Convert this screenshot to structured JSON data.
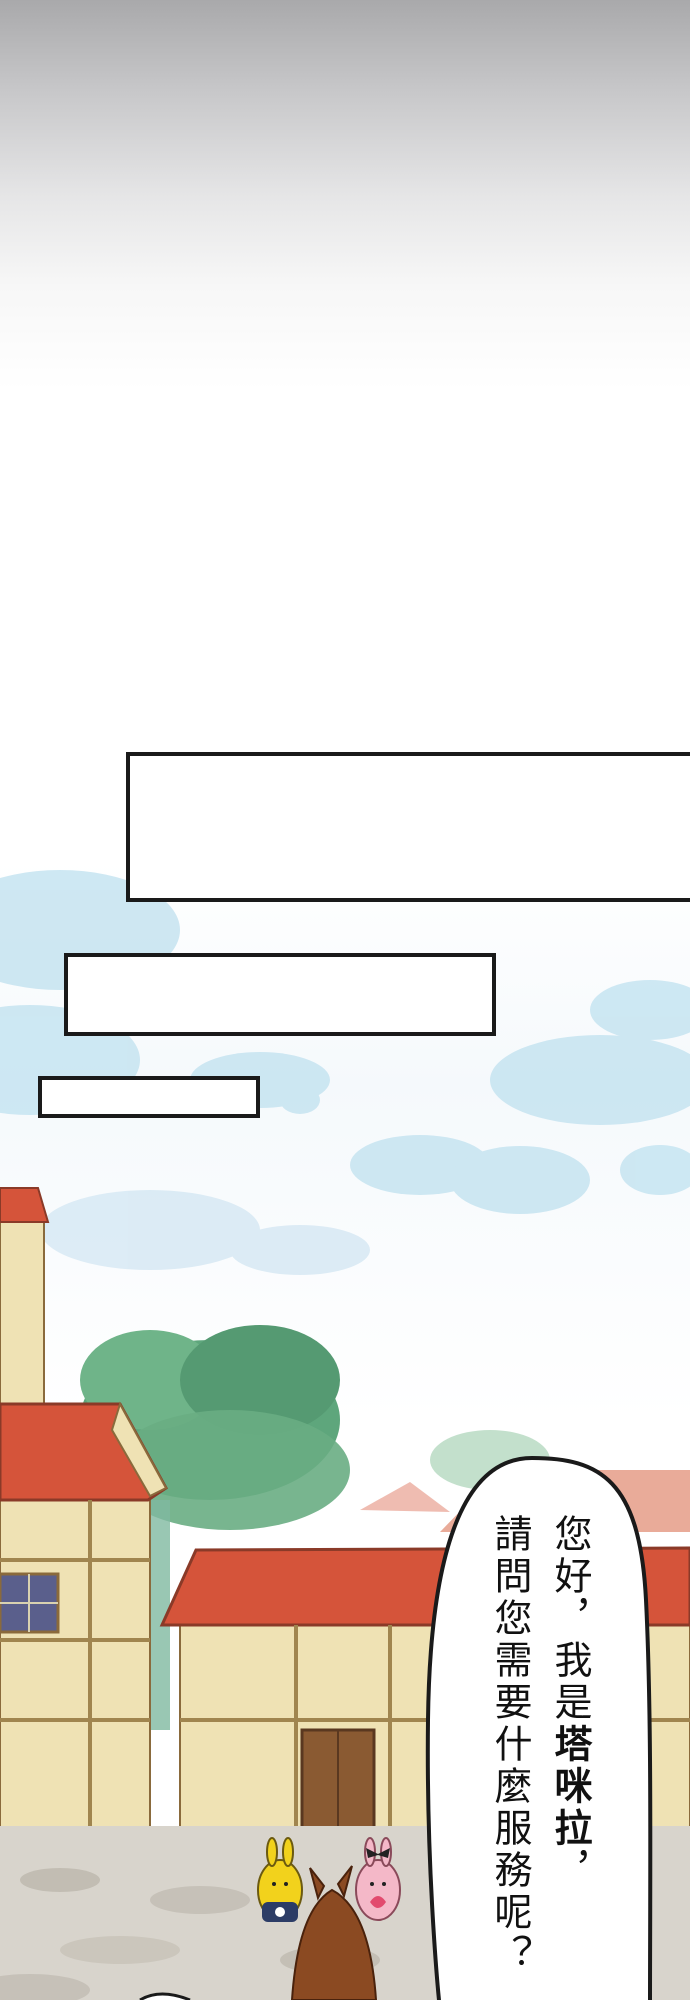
{
  "panel": {
    "speech_bubble": {
      "line1_prefix": "您好，我是",
      "line1_name": "塔咪拉",
      "line1_suffix": "，",
      "line2": "請問您需要什麼服務呢？"
    }
  },
  "colors": {
    "sky_top": "#a9a9ab",
    "sky_blue": "#bfe1f0",
    "roof_red": "#d5543a",
    "wall_cream": "#efe2b4",
    "tree_green": "#5ea67c",
    "ground": "#d8d4cc"
  }
}
